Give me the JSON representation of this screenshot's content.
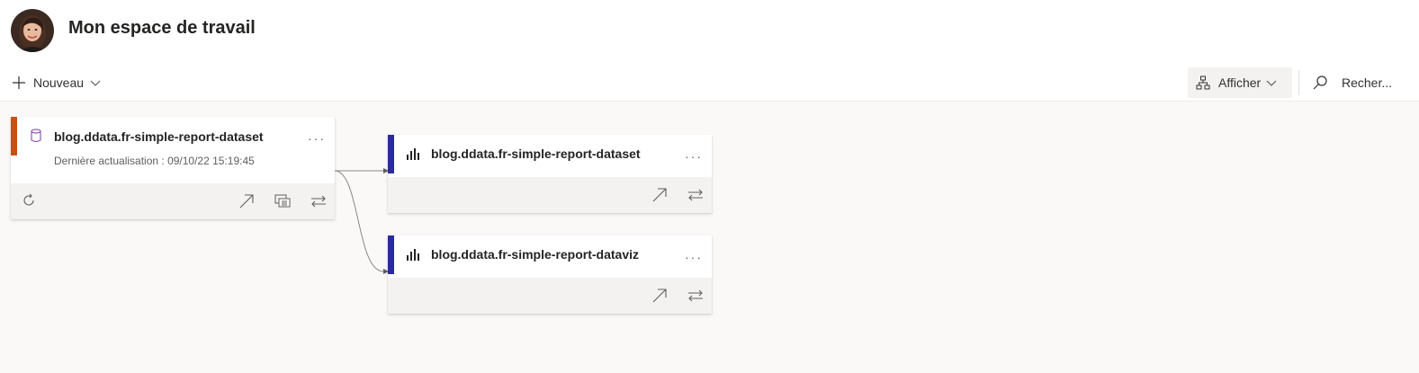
{
  "workspace": {
    "title": "Mon espace de travail"
  },
  "toolbar": {
    "new_label": "Nouveau",
    "view_label": "Afficher",
    "search_placeholder": "Recher..."
  },
  "colors": {
    "dataset_accent": "#ca5010",
    "report_accent": "#2b2b9f"
  },
  "cards": [
    {
      "type": "dataset",
      "name": "blog.ddata.fr-simple-report-dataset",
      "last_refresh": "Dernière actualisation : 09/10/22 15:19:45",
      "type_icon": "database-icon",
      "actions": [
        "refresh-icon",
        "open-arrow-icon",
        "analyze-icon",
        "lineage-icon"
      ]
    },
    {
      "type": "report",
      "name": "blog.ddata.fr-simple-report-dataset",
      "type_icon": "bar-chart-icon",
      "actions": [
        "open-arrow-icon",
        "lineage-icon"
      ]
    },
    {
      "type": "report",
      "name": "blog.ddata.fr-simple-report-dataviz",
      "type_icon": "bar-chart-icon",
      "actions": [
        "open-arrow-icon",
        "lineage-icon"
      ]
    }
  ]
}
